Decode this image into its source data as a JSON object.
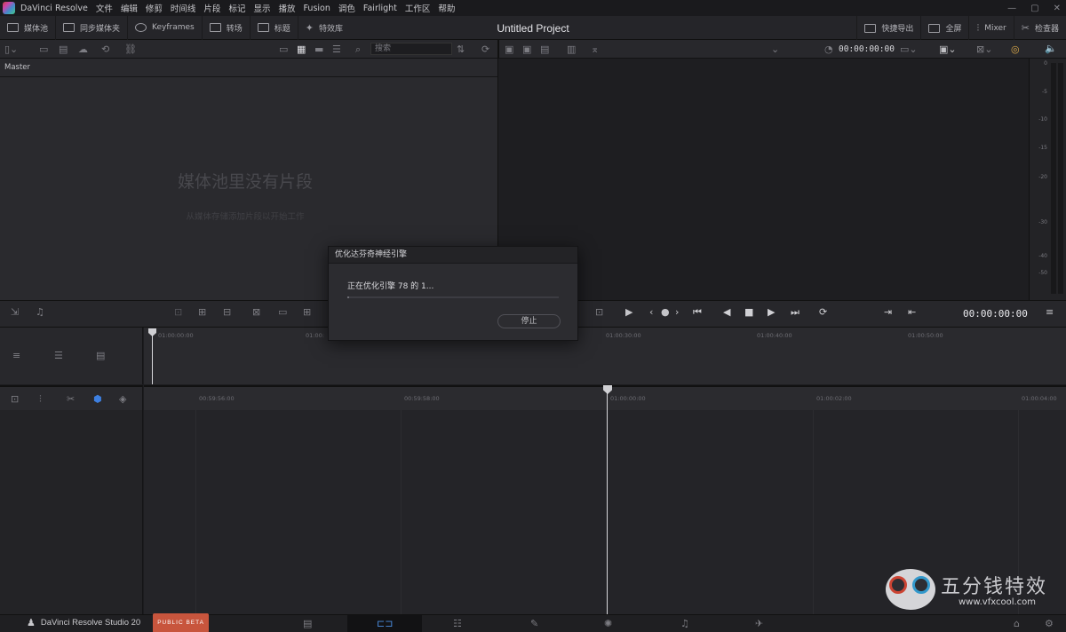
{
  "menubar": {
    "app_name": "DaVinci Resolve",
    "items": [
      "文件",
      "编辑",
      "修剪",
      "时间线",
      "片段",
      "标记",
      "显示",
      "播放",
      "Fusion",
      "调色",
      "Fairlight",
      "工作区",
      "帮助"
    ],
    "window_controls": [
      "—",
      "▢",
      "✕"
    ]
  },
  "toolbar": {
    "left": [
      {
        "label": "媒体池",
        "icon": "media-pool-icon"
      },
      {
        "label": "同步媒体夹",
        "icon": "sync-bin-icon"
      },
      {
        "label": "Keyframes",
        "icon": "keyframes-icon"
      },
      {
        "label": "转场",
        "icon": "transitions-icon"
      },
      {
        "label": "标题",
        "icon": "titles-icon"
      },
      {
        "label": "特效库",
        "icon": "effects-icon"
      }
    ],
    "project_title": "Untitled Project",
    "right": [
      {
        "label": "快捷导出",
        "icon": "quick-export-icon"
      },
      {
        "label": "全屏",
        "icon": "fullscreen-icon"
      },
      {
        "label": "Mixer",
        "icon": "mixer-icon"
      },
      {
        "label": "检查器",
        "icon": "inspector-icon"
      }
    ]
  },
  "subbar": {
    "search_placeholder": "搜索",
    "viewer_timecode": "00:00:00:00"
  },
  "media_pool": {
    "header": "Master",
    "empty_title": "媒体池里没有片段",
    "empty_subtitle": "从媒体存储添加片段以开始工作"
  },
  "meter": {
    "ticks": [
      "0",
      "-5",
      "-10",
      "-15",
      "-20",
      "-30",
      "-40",
      "-50"
    ]
  },
  "transport": {
    "timecode": "00:00:00:00"
  },
  "upper_timeline": {
    "ruler": [
      "01:00:00:00",
      "01:00:",
      "01:00:30:00",
      "01:00:40:00",
      "01:00:50:00"
    ]
  },
  "lower_timeline": {
    "ruler": [
      "00:59:56:00",
      "00:59:58:00",
      "01:00:00:00",
      "01:00:02:00",
      "01:00:04:00"
    ]
  },
  "dialog": {
    "title": "优化达芬奇神经引擎",
    "message": "正在优化引擎 78 的 1...",
    "progress": 0.01,
    "stop_label": "停止"
  },
  "pagebar": {
    "brand": "DaVinci Resolve Studio 20",
    "beta": "PUBLIC BETA"
  },
  "watermark": {
    "chinese": "五分钱特效",
    "url": "www.vfxcool.com"
  }
}
